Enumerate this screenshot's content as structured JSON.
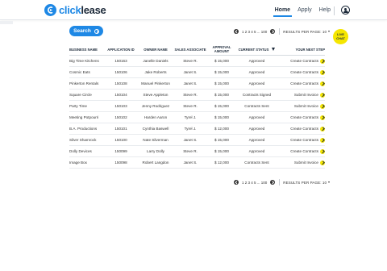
{
  "brand": {
    "name_part1": "click",
    "name_part2": "lease"
  },
  "nav": {
    "items": [
      "Home",
      "Apply",
      "Help"
    ],
    "active": "Home"
  },
  "toolbar": {
    "search_label": "Search",
    "pages_text": "1 2 3 4 5 ... 100",
    "results_per_page_label": "RESULTS PER PAGE: 10"
  },
  "live_chat": {
    "line1": "LIVE",
    "line2": "CHAT"
  },
  "table": {
    "headers": {
      "business_name": "BUSINESS NAME",
      "application_id": "APPLICATION ID",
      "owner_name": "OWNER NAME",
      "sales_associate": "SALES ASSOCIATE",
      "approval_amount": "APPROVAL AMOUNT",
      "current_status": "CURRENT STATUS",
      "next_step": "YOUR NEXT STEP"
    },
    "rows": [
      {
        "business": "Big Time Kitchens",
        "app_id": "150163",
        "owner": "Janelle Daniels",
        "sales": "Steve R.",
        "amount": "$ 15,000",
        "status": "Approved",
        "next": "Create Contracts"
      },
      {
        "business": "Cosmic Eats",
        "app_id": "150106",
        "owner": "Jake Roberts",
        "sales": "Janet S.",
        "amount": "$ 15,000",
        "status": "Approved",
        "next": "Create Contracts"
      },
      {
        "business": "Pinkerton Rentals",
        "app_id": "150108",
        "owner": "Manuel Pinkerton",
        "sales": "Janet S.",
        "amount": "$ 15,000",
        "status": "Approved",
        "next": "Create Contracts"
      },
      {
        "business": "Square Circle",
        "app_id": "150104",
        "owner": "Steve Appleton",
        "sales": "Steve R.",
        "amount": "$ 15,000",
        "status": "Contracts Signed",
        "next": "Submit Invoice"
      },
      {
        "business": "Party Time",
        "app_id": "150103",
        "owner": "Jenny Rodriguez",
        "sales": "Steve R.",
        "amount": "$ 15,000",
        "status": "Contracts Sent",
        "next": "Submit Invoice"
      },
      {
        "business": "Meeting Potpourri",
        "app_id": "150102",
        "owner": "Harden Aaron",
        "sales": "Tyrel J.",
        "amount": "$ 15,000",
        "status": "Approved",
        "next": "Create Contracts"
      },
      {
        "business": "B.A. Productions",
        "app_id": "150101",
        "owner": "Cynthia Baswell",
        "sales": "Tyrel J.",
        "amount": "$ 12,000",
        "status": "Approved",
        "next": "Create Contracts"
      },
      {
        "business": "Silver Shamrock",
        "app_id": "150100",
        "owner": "Nate Silverman",
        "sales": "Janet S.",
        "amount": "$ 15,000",
        "status": "Approved",
        "next": "Create Contracts"
      },
      {
        "business": "Dolly Devices",
        "app_id": "150099",
        "owner": "Larry Dolly",
        "sales": "Steve R.",
        "amount": "$ 15,000",
        "status": "Approved",
        "next": "Create Contracts"
      },
      {
        "business": "Image Box",
        "app_id": "150098",
        "owner": "Robert Langdon",
        "sales": "Janet S.",
        "amount": "$ 12,000",
        "status": "Contracts Sent",
        "next": "Submit Invoice"
      }
    ]
  },
  "colors": {
    "accent": "#1e88e5",
    "chat": "#f5e600",
    "text_dark": "#1d2a3a"
  }
}
